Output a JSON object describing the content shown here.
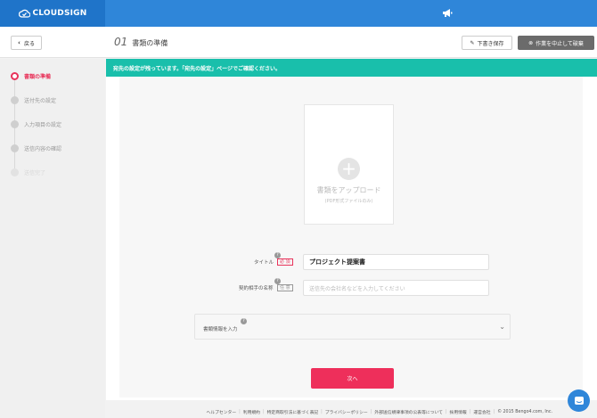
{
  "app": {
    "logo_text": "CLOUDSIGN"
  },
  "header": {
    "back_label": "戻る",
    "step_number": "01",
    "step_name": "書類の準備",
    "draft_label": "下書き保存",
    "abort_label": "作業を中止して破棄"
  },
  "sidebar": {
    "steps": [
      {
        "label": "書類の準備",
        "state": "active"
      },
      {
        "label": "送付先の設定",
        "state": "pending"
      },
      {
        "label": "入力項目の設定",
        "state": "pending"
      },
      {
        "label": "送信内容の確認",
        "state": "pending"
      },
      {
        "label": "送信完了",
        "state": "disabled"
      }
    ]
  },
  "alert": {
    "message": "宛先の設定が残っています。「宛先の設定」ページでご確認ください。"
  },
  "upload": {
    "label": "書類をアップロード",
    "sublabel": "(PDF形式ファイルのみ)"
  },
  "form": {
    "title_label": "タイトル",
    "required_badge": "必 須",
    "title_value": "プロジェクト提案書",
    "partner_label": "契約相手の名称",
    "optional_badge": "任 意",
    "partner_placeholder": "送信先の会社名などを入力してください",
    "help_mark": "?"
  },
  "accordion": {
    "label": "書類情報を入力"
  },
  "next_label": "次へ",
  "footer": {
    "links": [
      "ヘルプセンター",
      "利用規約",
      "特定商取引法に基づく表記",
      "プライバシーポリシー",
      "外部送信規律事項の公表等について",
      "採用情報",
      "運営会社"
    ],
    "copyright": "© 2015 Bengo4.com, Inc."
  },
  "colors": {
    "brand_blue": "#2f86d9",
    "accent_red": "#ee2f5b",
    "alert_teal": "#19bfab"
  }
}
